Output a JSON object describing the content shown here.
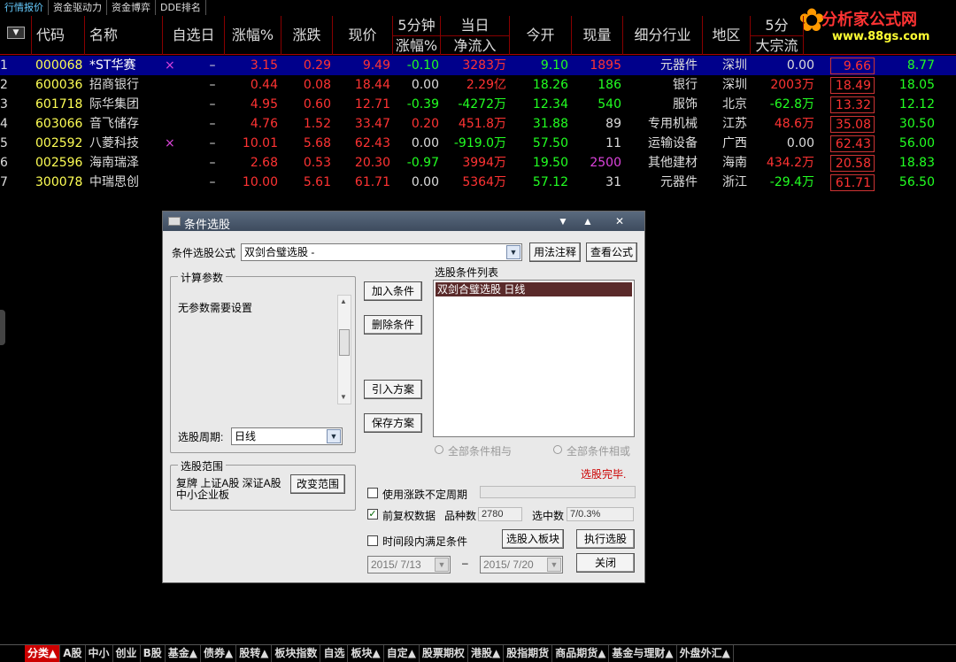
{
  "top_tabs": [
    "行情报价",
    "资金驱动力",
    "资金博弈",
    "DDE排名"
  ],
  "logo": {
    "title": "分析家公式网",
    "url": "www.88gs.com"
  },
  "headers": {
    "code": "代码",
    "name": "名称",
    "dot": "•",
    "selday": "自选日",
    "pct": "涨幅%",
    "chg": "涨跌",
    "price": "现价",
    "min5_top": "5分钟",
    "min5_bot": "涨幅%",
    "day_top": "当日",
    "day_bot": "净流入",
    "open": "今开",
    "vol": "现量",
    "industry": "细分行业",
    "region": "地区",
    "big_top": "5分",
    "big_bot": "大宗流入",
    "col_a": "",
    "col_b": ""
  },
  "rows": [
    {
      "idx": "1",
      "code": "000068",
      "name": "*ST华赛",
      "mark": "×",
      "sel": "–",
      "pct": "3.15",
      "chg": "0.29",
      "price": "9.49",
      "m5": "-0.10",
      "flow": "3283万",
      "open": "9.10",
      "vol": "1895",
      "ind": "元器件",
      "reg": "深圳",
      "big": "0.00",
      "a": "9.66",
      "b": "8.77"
    },
    {
      "idx": "2",
      "code": "600036",
      "name": "招商银行",
      "mark": "",
      "sel": "–",
      "pct": "0.44",
      "chg": "0.08",
      "price": "18.44",
      "m5": "0.00",
      "flow": "2.29亿",
      "open": "18.26",
      "vol": "186",
      "ind": "银行",
      "reg": "深圳",
      "big": "2003万",
      "a": "18.49",
      "b": "18.05"
    },
    {
      "idx": "3",
      "code": "601718",
      "name": "际华集团",
      "mark": "",
      "sel": "–",
      "pct": "4.95",
      "chg": "0.60",
      "price": "12.71",
      "m5": "-0.39",
      "flow": "-4272万",
      "open": "12.34",
      "vol": "540",
      "ind": "服饰",
      "reg": "北京",
      "big": "-62.8万",
      "a": "13.32",
      "b": "12.12"
    },
    {
      "idx": "4",
      "code": "603066",
      "name": "音飞储存",
      "mark": "",
      "sel": "–",
      "pct": "4.76",
      "chg": "1.52",
      "price": "33.47",
      "m5": "0.20",
      "flow": "451.8万",
      "open": "31.88",
      "vol": "89",
      "ind": "专用机械",
      "reg": "江苏",
      "big": "48.6万",
      "a": "35.08",
      "b": "30.50"
    },
    {
      "idx": "5",
      "code": "002592",
      "name": "八菱科技",
      "mark": "×",
      "sel": "–",
      "pct": "10.01",
      "chg": "5.68",
      "price": "62.43",
      "m5": "0.00",
      "flow": "-919.0万",
      "open": "57.50",
      "vol": "11",
      "ind": "运输设备",
      "reg": "广西",
      "big": "0.00",
      "a": "62.43",
      "b": "56.00"
    },
    {
      "idx": "6",
      "code": "002596",
      "name": "海南瑞泽",
      "mark": "",
      "sel": "–",
      "pct": "2.68",
      "chg": "0.53",
      "price": "20.30",
      "m5": "-0.97",
      "flow": "3994万",
      "open": "19.50",
      "vol": "2500",
      "ind": "其他建材",
      "reg": "海南",
      "big": "434.2万",
      "a": "20.58",
      "b": "18.83"
    },
    {
      "idx": "7",
      "code": "300078",
      "name": "中瑞思创",
      "mark": "",
      "sel": "–",
      "pct": "10.00",
      "chg": "5.61",
      "price": "61.71",
      "m5": "0.00",
      "flow": "5364万",
      "open": "57.12",
      "vol": "31",
      "ind": "元器件",
      "reg": "浙江",
      "big": "-29.4万",
      "a": "61.71",
      "b": "56.50"
    }
  ],
  "dialog": {
    "title": "条件选股",
    "formula_label": "条件选股公式",
    "formula_value": "双剑合璧选股 -",
    "btn_usage": "用法注释",
    "btn_view": "查看公式",
    "params_title": "计算参数",
    "params_text": "无参数需要设置",
    "period_label": "选股周期:",
    "period_value": "日线",
    "range_title": "选股范围",
    "range_text": "复牌 上证A股 深证A股 中小企业板",
    "btn_change_range": "改变范围",
    "btn_add": "加入条件",
    "btn_delete": "删除条件",
    "btn_import": "引入方案",
    "btn_save": "保存方案",
    "list_title": "选股条件列表",
    "list_items": [
      "双剑合璧选股  日线"
    ],
    "radio_and": "全部条件相与",
    "radio_or": "全部条件相或",
    "status": "选股完毕.",
    "chk_uncertain": "使用涨跌不定周期",
    "chk_adjust": "前复权数据",
    "count_label": "品种数",
    "count_value": "2780",
    "hit_label": "选中数",
    "hit_value": "7/0.3%",
    "chk_timerange": "时间段内满足条件",
    "btn_to_block": "选股入板块",
    "btn_execute": "执行选股",
    "btn_close": "关闭",
    "date_from": "2015/ 7/13",
    "date_to": "2015/ 7/20",
    "date_sep": "–"
  },
  "bottom_tabs": [
    "分类▲",
    "A股",
    "中小",
    "创业",
    "B股",
    "基金▲",
    "债券▲",
    "股转▲",
    "板块指数",
    "自选",
    "板块▲",
    "自定▲",
    "股票期权",
    "港股▲",
    "股指期货",
    "商品期货▲",
    "基金与理财▲",
    "外盘外汇▲"
  ]
}
